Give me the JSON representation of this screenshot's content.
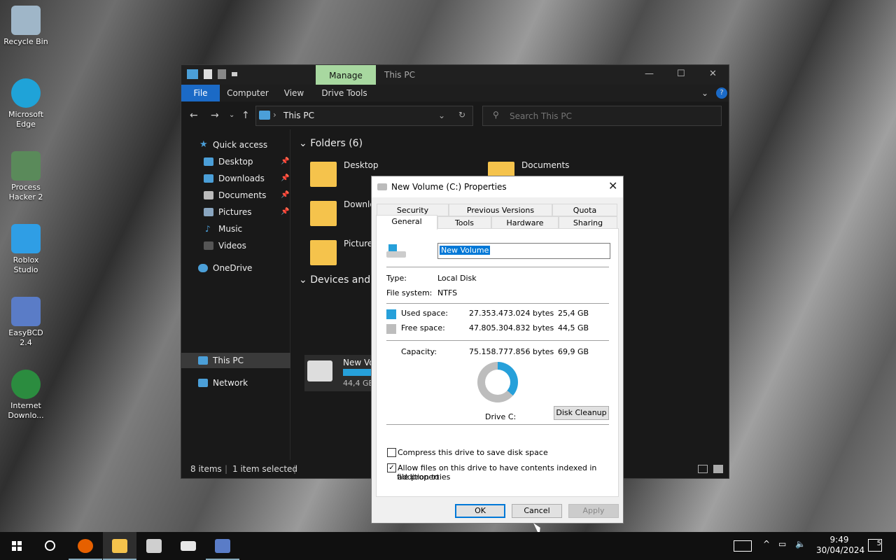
{
  "desktop": {
    "icons": [
      {
        "label": "Recycle Bin",
        "color": "#9fb6c8"
      },
      {
        "label": "Microsoft Edge",
        "color": "#1fa3d8"
      },
      {
        "label": "Process Hacker 2",
        "color": "#5a8a5a"
      },
      {
        "label": "Roblox Studio",
        "color": "#2f9ee5"
      },
      {
        "label": "EasyBCD 2.4",
        "color": "#5a7cc7"
      },
      {
        "label": "Internet Downlo...",
        "color": "#2b8c3f"
      }
    ]
  },
  "explorer": {
    "manage_tab": "Manage",
    "title": "This PC",
    "ribbon_tabs": [
      "File",
      "Computer",
      "View",
      "Drive Tools"
    ],
    "address": "This PC",
    "search_placeholder": "Search This PC",
    "nav": {
      "quick_access": "Quick access",
      "items": [
        "Desktop",
        "Downloads",
        "Documents",
        "Pictures",
        "Music",
        "Videos"
      ],
      "onedrive": "OneDrive",
      "this_pc": "This PC",
      "network": "Network"
    },
    "folders_header": "Folders (6)",
    "devices_header": "Devices and d",
    "folders": [
      "Desktop",
      "Documents",
      "Downlo",
      "Pictures"
    ],
    "drive": {
      "name": "New Vo",
      "free": "44,4 GB"
    },
    "status": {
      "items": "8 items",
      "selected": "1 item selected"
    }
  },
  "dialog": {
    "title": "New Volume (C:) Properties",
    "tabs_top": [
      "Security",
      "Previous Versions",
      "Quota"
    ],
    "tabs_bottom": [
      "General",
      "Tools",
      "Hardware",
      "Sharing"
    ],
    "volume_name": "New Volume",
    "type_label": "Type:",
    "type_value": "Local Disk",
    "fs_label": "File system:",
    "fs_value": "NTFS",
    "used_label": "Used space:",
    "used_bytes": "27.353.473.024 bytes",
    "used_gb": "25,4 GB",
    "free_label": "Free space:",
    "free_bytes": "47.805.304.832 bytes",
    "free_gb": "44,5 GB",
    "cap_label": "Capacity:",
    "cap_bytes": "75.158.777.856 bytes",
    "cap_gb": "69,9 GB",
    "used_fraction": 0.364,
    "drive_label": "Drive C:",
    "cleanup": "Disk Cleanup",
    "compress": "Compress this drive to save disk space",
    "compress_checked": false,
    "index_line1": "Allow files on this drive to have contents indexed in addition to",
    "index_line2": "file properties",
    "index_checked": true,
    "ok": "OK",
    "cancel": "Cancel",
    "apply": "Apply",
    "colors": {
      "used": "#26a0da",
      "free": "#bdbdbd"
    }
  },
  "taskbar": {
    "time": "9:49",
    "date": "30/04/2024",
    "notifications": "5"
  }
}
